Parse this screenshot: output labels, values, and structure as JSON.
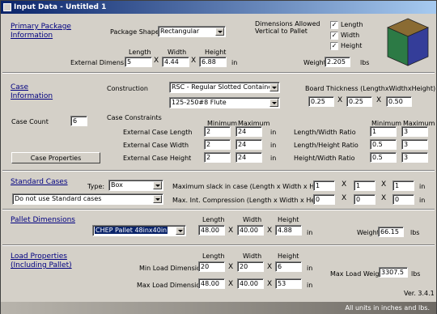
{
  "window": {
    "title": "Input Data - Untitled 1"
  },
  "primary": {
    "section_line1": "Primary Package",
    "section_line2": "Information",
    "shape_label": "Package Shape",
    "shape_value": "Rectangular",
    "dims_allowed_line1": "Dimensions Allowed",
    "dims_allowed_line2": "Vertical to Pallet",
    "checks": [
      {
        "label": "Length",
        "checked": true
      },
      {
        "label": "Width",
        "checked": true
      },
      {
        "label": "Height",
        "checked": true
      }
    ],
    "col_length": "Length",
    "col_width": "Width",
    "col_height": "Height",
    "ext_label": "External Dimensions",
    "length": "5",
    "width": "4.44",
    "height": "6.88",
    "unit_in": "in",
    "weight_label": "Weight",
    "weight": "2.205",
    "weight_unit": "lbs"
  },
  "case": {
    "section_line1": "Case",
    "section_line2": "Information",
    "construction_label": "Construction",
    "construction_value": "RSC - Regular Slotted Container",
    "flute_value": "125-250#8 Flute",
    "board_label": "Board Thickness (LengthxWidthxHeight)",
    "board_l": "0.25",
    "board_w": "0.25",
    "board_h": "0.50",
    "count_label": "Case Count",
    "count_value": "6",
    "constraints_label": "Case Constraints",
    "min_hdr": "Minimum",
    "max_hdr": "Maximum",
    "rows": [
      {
        "label": "External Case Length",
        "min": "2",
        "max": "24",
        "unit": "in"
      },
      {
        "label": "External Case Width",
        "min": "2",
        "max": "24",
        "unit": "in"
      },
      {
        "label": "External Case Height",
        "min": "2",
        "max": "24",
        "unit": "in"
      }
    ],
    "ratios": [
      {
        "label": "Length/Width Ratio",
        "min": "1",
        "max": "3"
      },
      {
        "label": "Length/Height Ratio",
        "min": "0.5",
        "max": "3"
      },
      {
        "label": "Height/Width Ratio",
        "min": "0.5",
        "max": "3"
      }
    ],
    "properties_button": "Case Properties"
  },
  "standard": {
    "section": "Standard Cases",
    "type_label": "Type:",
    "type_value": "Box",
    "std_value": "Do not use Standard cases",
    "slack_label": "Maximum slack in case  (Length x Width x Height)",
    "slack": [
      "1",
      "1",
      "1"
    ],
    "compression_label": "Max. Int. Compression (Length x Width x Height)",
    "compression": [
      "0",
      "0",
      "0"
    ],
    "unit_in": "in"
  },
  "pallet": {
    "section": "Pallet Dimensions",
    "pallet_value": "CHEP Pallet 48inx40in",
    "col_length": "Length",
    "col_width": "Width",
    "col_height": "Height",
    "length": "48.00",
    "width": "40.00",
    "height": "4.88",
    "unit_in": "in",
    "weight_label": "Weight",
    "weight": "66.15",
    "weight_unit": "lbs"
  },
  "load": {
    "section_line1": "Load Properties",
    "section_line2": "(Including Pallet)",
    "col_length": "Length",
    "col_width": "Width",
    "col_height": "Height",
    "min_label": "Min Load Dimensions",
    "min": [
      "20",
      "20",
      "6"
    ],
    "max_label": "Max Load Dimensions",
    "max": [
      "48.00",
      "40.00",
      "53"
    ],
    "unit_in": "in",
    "max_weight_label": "Max Load Weight",
    "max_weight": "3307.5",
    "max_weight_unit": "lbs"
  },
  "version": "Ver. 3.4.1",
  "status": "All units in inches and lbs.",
  "colors": {
    "title_start": "#0a246a",
    "title_end": "#a6caf0",
    "section_text": "#000080",
    "cube_top": "#8a6b33",
    "cube_left": "#2c7a45",
    "cube_right": "#343d99"
  }
}
